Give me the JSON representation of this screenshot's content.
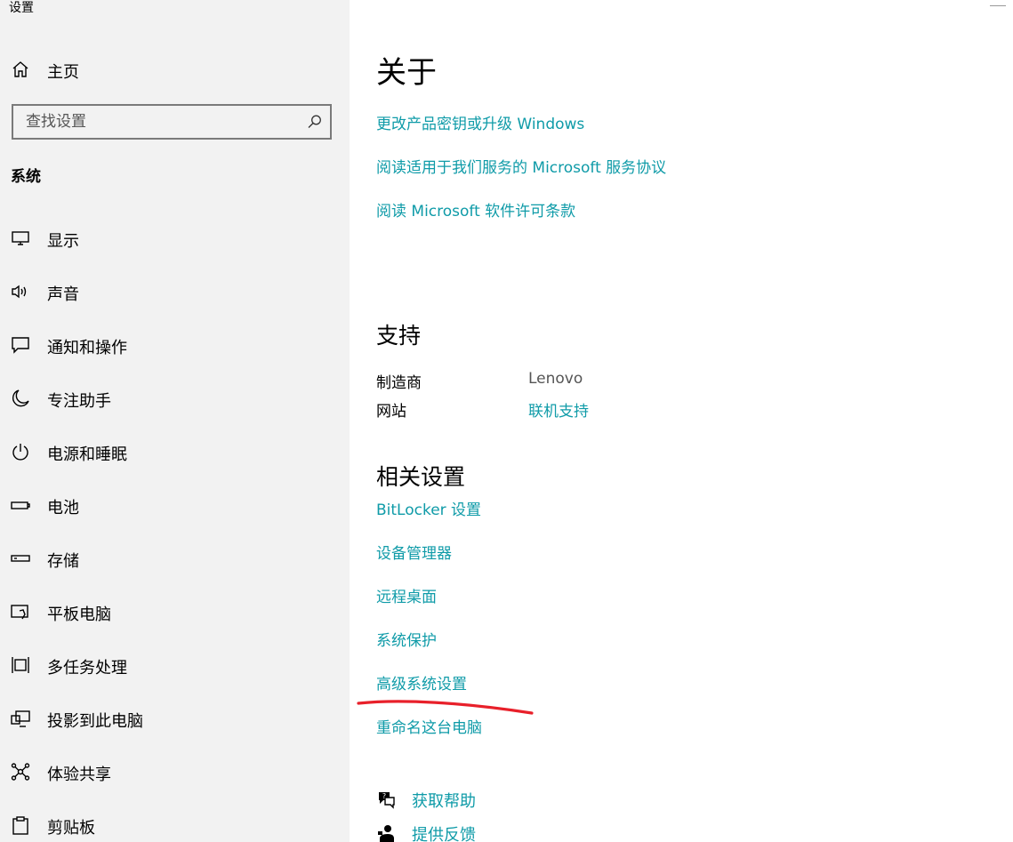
{
  "window": {
    "title": "设置"
  },
  "sidebar": {
    "home_label": "主页",
    "search_placeholder": "查找设置",
    "section_heading": "系统",
    "items": [
      {
        "label": "显示",
        "icon": "monitor-icon"
      },
      {
        "label": "声音",
        "icon": "speaker-icon"
      },
      {
        "label": "通知和操作",
        "icon": "message-icon"
      },
      {
        "label": "专注助手",
        "icon": "moon-icon"
      },
      {
        "label": "电源和睡眠",
        "icon": "power-icon"
      },
      {
        "label": "电池",
        "icon": "battery-icon"
      },
      {
        "label": "存储",
        "icon": "storage-icon"
      },
      {
        "label": "平板电脑",
        "icon": "tablet-icon"
      },
      {
        "label": "多任务处理",
        "icon": "multitask-icon"
      },
      {
        "label": "投影到此电脑",
        "icon": "project-icon"
      },
      {
        "label": "体验共享",
        "icon": "share-icon"
      },
      {
        "label": "剪贴板",
        "icon": "clipboard-icon"
      }
    ]
  },
  "main": {
    "title": "关于",
    "about_links": [
      "更改产品密钥或升级 Windows",
      "阅读适用于我们服务的 Microsoft 服务协议",
      "阅读 Microsoft 软件许可条款"
    ],
    "support": {
      "heading": "支持",
      "manufacturer_label": "制造商",
      "manufacturer_value": "Lenovo",
      "website_label": "网站",
      "website_value": "联机支持"
    },
    "related": {
      "heading": "相关设置",
      "links": [
        "BitLocker 设置",
        "设备管理器",
        "远程桌面",
        "系统保护",
        "高级系统设置",
        "重命名这台电脑"
      ]
    },
    "help": {
      "get_help": "获取帮助",
      "feedback": "提供反馈"
    }
  },
  "colors": {
    "link": "#0f9ba8",
    "sidebar_bg": "#f2f2f2",
    "annotation": "#e8202a"
  }
}
